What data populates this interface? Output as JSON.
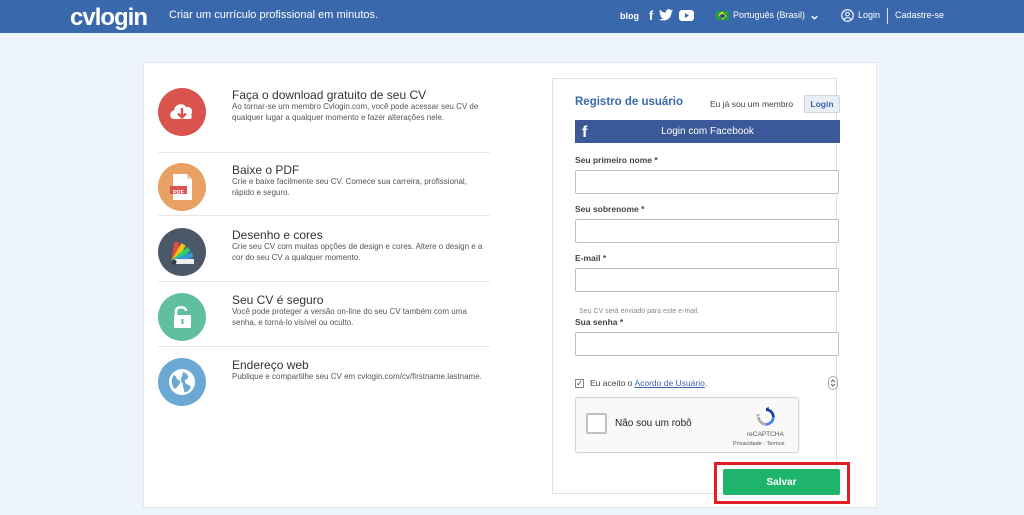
{
  "header": {
    "logo": "cvlogin",
    "tagline": "Criar um currículo profissional em minutos.",
    "blog": "blog",
    "facebook_icon": "f",
    "language": "Português (Brasil)",
    "login": "Login",
    "signup": "Cadastre-se"
  },
  "features": [
    {
      "title": "Faça o download gratuito de seu CV",
      "desc": "Ao tornar-se um membro Cvlogin.com, você pode acessar seu CV de qualquer lugar a qualquer momento e fazer alterações nele.",
      "icon": "download-icon",
      "color": "#d9534f"
    },
    {
      "title": "Baixe o PDF",
      "desc": "Crie e baixe facilmente seu CV. Comece sua carreira, profissional, rápido e seguro.",
      "icon": "pdf-icon",
      "color": "#e8a063"
    },
    {
      "title": "Desenho e cores",
      "desc": "Crie seu CV com muitas opções de design e cores. Altere o design e a cor do seu CV a qualquer momento.",
      "icon": "color-palette-icon",
      "color": "#4a5867"
    },
    {
      "title": "Seu CV é seguro",
      "desc": "Você pode proteger a versão on-line do seu CV também com uma senha, e torná-lo visível ou oculto.",
      "icon": "lock-icon",
      "color": "#5fbf9f"
    },
    {
      "title": "Endereço web",
      "desc": "Publique e compartilhe seu CV em cvlogin.com/cv/firstname.lastname.",
      "icon": "globe-icon",
      "color": "#6ba8d3"
    }
  ],
  "pdf_badge": "PDF",
  "form": {
    "title": "Registro de usuário",
    "member_text": "Eu já sou um membro",
    "login_button": "Login",
    "facebook_f": "f",
    "facebook_button": "Login com Facebook",
    "first_name_label": "Seu primeiro nome *",
    "first_name_value": "",
    "last_name_label": "Seu sobrenome *",
    "last_name_value": "",
    "email_label": "E-mail *",
    "email_value": "",
    "email_help": "Seu CV será enviado para este e-mail.",
    "password_label": "Sua senha *",
    "password_value": "",
    "agree_checkmark": "✓",
    "agree_prefix": "Eu aceito o",
    "agree_link": "Acordo de Usuário",
    "agree_suffix": ".",
    "recaptcha_label": "Não sou um robô",
    "recaptcha_brand": "reCAPTCHA",
    "recaptcha_links": "Privacidade - Termos",
    "save_button": "Salvar"
  },
  "colors": {
    "header_bg": "#3a68ad",
    "facebook": "#3b5998",
    "save": "#1eb46c",
    "highlight": "#e21d24"
  }
}
